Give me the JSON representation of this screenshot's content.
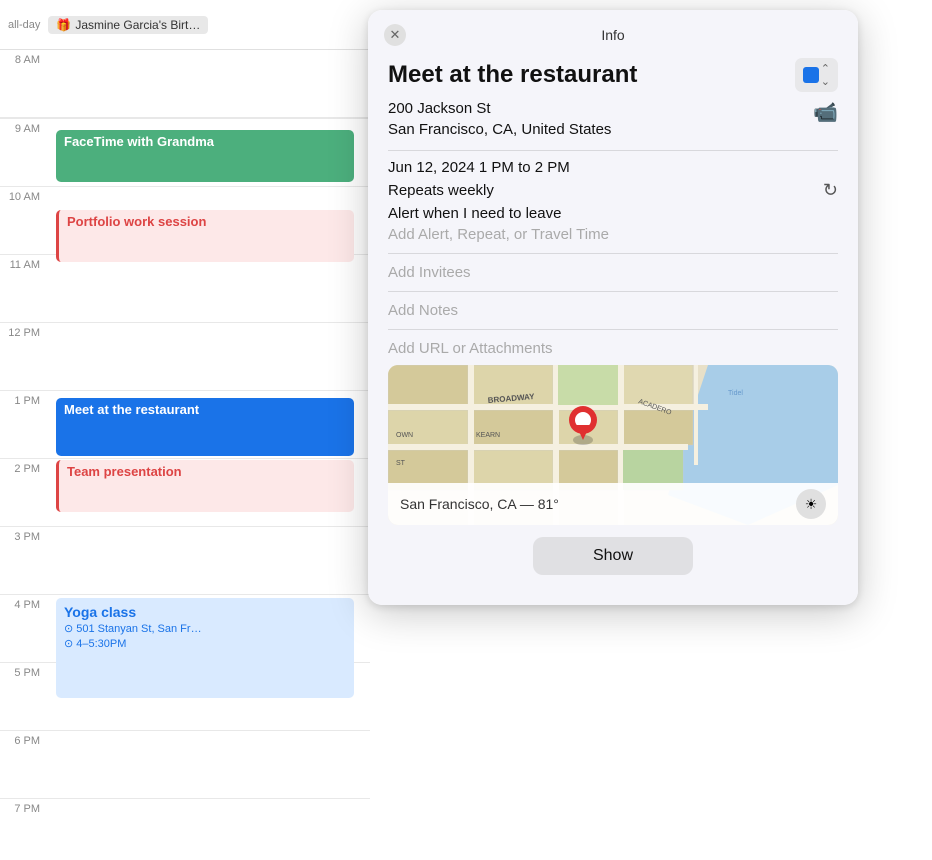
{
  "calendar": {
    "all_day_label": "all-day",
    "all_day_event": {
      "icon": "🎁",
      "text": "Jasmine Garcia's Birt…"
    },
    "time_slots": [
      {
        "label": "8 AM"
      },
      {
        "label": "9 AM"
      },
      {
        "label": "10 AM"
      },
      {
        "label": "11 AM"
      },
      {
        "label": "12 PM"
      },
      {
        "label": "1 PM"
      },
      {
        "label": "2 PM"
      },
      {
        "label": "3 PM"
      },
      {
        "label": "4 PM"
      },
      {
        "label": "5 PM"
      },
      {
        "label": "6 PM"
      },
      {
        "label": "7 PM"
      }
    ],
    "events": {
      "facetime": "FaceTime with Grandma",
      "portfolio": "Portfolio work session",
      "restaurant": "Meet at the restaurant",
      "team": "Team presentation",
      "yoga": {
        "title": "Yoga class",
        "location": "501 Stanyan St, San Fr…",
        "time": "4–5:30PM"
      }
    }
  },
  "popup": {
    "header_title": "Info",
    "event_title": "Meet at the restaurant",
    "location_line1": "200 Jackson St",
    "location_line2": "San Francisco, CA, United States",
    "date_time": "Jun 12, 2024  1 PM to 2 PM",
    "repeats": "Repeats weekly",
    "alert": "Alert when I need to leave",
    "add_alert": "Add Alert, Repeat, or Travel Time",
    "add_invitees": "Add Invitees",
    "add_notes": "Add Notes",
    "add_url": "Add URL or Attachments",
    "map_location": "San Francisco, CA — 81°",
    "show_button": "Show",
    "color": "#1a73e8"
  }
}
